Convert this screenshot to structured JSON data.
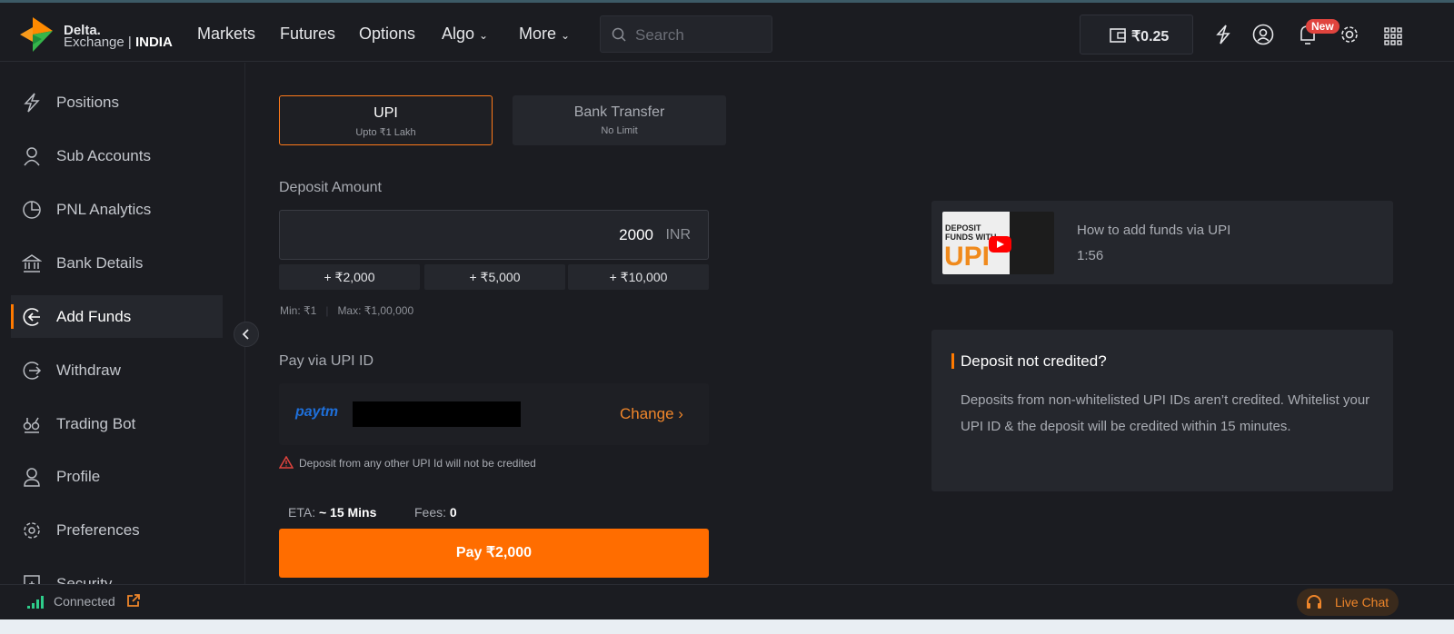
{
  "header": {
    "logo": {
      "line1": "Delta.",
      "line2a": "Exchange",
      "line2b": "INDIA"
    },
    "nav": [
      {
        "label": "Markets"
      },
      {
        "label": "Futures"
      },
      {
        "label": "Options"
      },
      {
        "label": "Algo"
      },
      {
        "label": "More"
      }
    ],
    "search_placeholder": "Search",
    "wallet_balance": "₹0.25",
    "notification_badge": "New"
  },
  "sidebar": {
    "items": [
      {
        "label": "Positions",
        "icon": "positions-icon"
      },
      {
        "label": "Sub Accounts",
        "icon": "user-icon"
      },
      {
        "label": "PNL Analytics",
        "icon": "pie-chart-icon"
      },
      {
        "label": "Bank Details",
        "icon": "bank-icon"
      },
      {
        "label": "Add Funds",
        "icon": "add-funds-icon",
        "active": true
      },
      {
        "label": "Withdraw",
        "icon": "withdraw-icon"
      },
      {
        "label": "Trading Bot",
        "icon": "bot-icon"
      },
      {
        "label": "Profile",
        "icon": "profile-icon"
      },
      {
        "label": "Preferences",
        "icon": "gear-icon"
      },
      {
        "label": "Security",
        "icon": "shield-icon"
      }
    ]
  },
  "main": {
    "tabs": [
      {
        "label": "UPI",
        "sub": "Upto ₹1 Lakh",
        "active": true
      },
      {
        "label": "Bank Transfer",
        "sub": "No Limit"
      }
    ],
    "deposit_label": "Deposit Amount",
    "amount_value": "2000",
    "currency": "INR",
    "quick_amounts": [
      "+ ₹2,000",
      "+ ₹5,000",
      "+ ₹10,000"
    ],
    "min": "Min: ₹1",
    "max": "Max: ₹1,00,000",
    "pay_via_label": "Pay via UPI ID",
    "upi_provider": "paytm",
    "change_label": "Change",
    "warning": "Deposit from any other UPI Id will not be credited",
    "eta_label": "ETA:",
    "eta_value": "~ 15 Mins",
    "fees_label": "Fees:",
    "fees_value": "0",
    "pay_button": "Pay ₹2,000"
  },
  "video": {
    "title": "How to add funds via UPI",
    "duration": "1:56",
    "thumb_line1": "DEPOSIT",
    "thumb_line2": "FUNDS WITH",
    "thumb_line3": "UPI"
  },
  "info": {
    "title": "Deposit not credited?",
    "body": "Deposits from non-whitelisted UPI IDs aren’t credited. Whitelist your UPI ID & the deposit will be credited within 15 minutes."
  },
  "status": {
    "connection": "Connected",
    "live_chat": "Live Chat"
  },
  "colors": {
    "accent": "#ff6d00",
    "background": "#1b1c21",
    "connected": "#2ecc8a",
    "badge": "#e0443e"
  }
}
